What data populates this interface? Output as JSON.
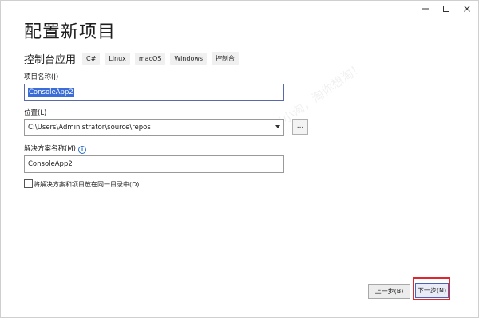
{
  "window": {
    "controls": [
      "minimize-icon",
      "maximize-icon",
      "close-icon"
    ]
  },
  "page": {
    "title": "配置新项目",
    "subtitle": "控制台应用",
    "tags": [
      "C#",
      "Linux",
      "macOS",
      "Windows",
      "控制台"
    ]
  },
  "form": {
    "project_name_label": "项目名称(J)",
    "project_name_value": "ConsoleApp2",
    "location_label": "位置(L)",
    "location_value": "C:\\Users\\Administrator\\source\\repos",
    "browse_label": "...",
    "solution_name_label": "解决方案名称(M)",
    "solution_name_value": "ConsoleApp2",
    "same_dir_checkbox_label": "将解决方案和项目放在同一目录中(D)",
    "same_dir_checked": false
  },
  "footer": {
    "back_label": "上一步(B)",
    "next_label": "下一步(N)"
  },
  "watermark": {
    "text": "Hi小淘，淘你想淘！"
  },
  "colors": {
    "selection": "#3b6dd8",
    "highlight": "#e0262f",
    "focus_border": "#5a6aa8"
  }
}
